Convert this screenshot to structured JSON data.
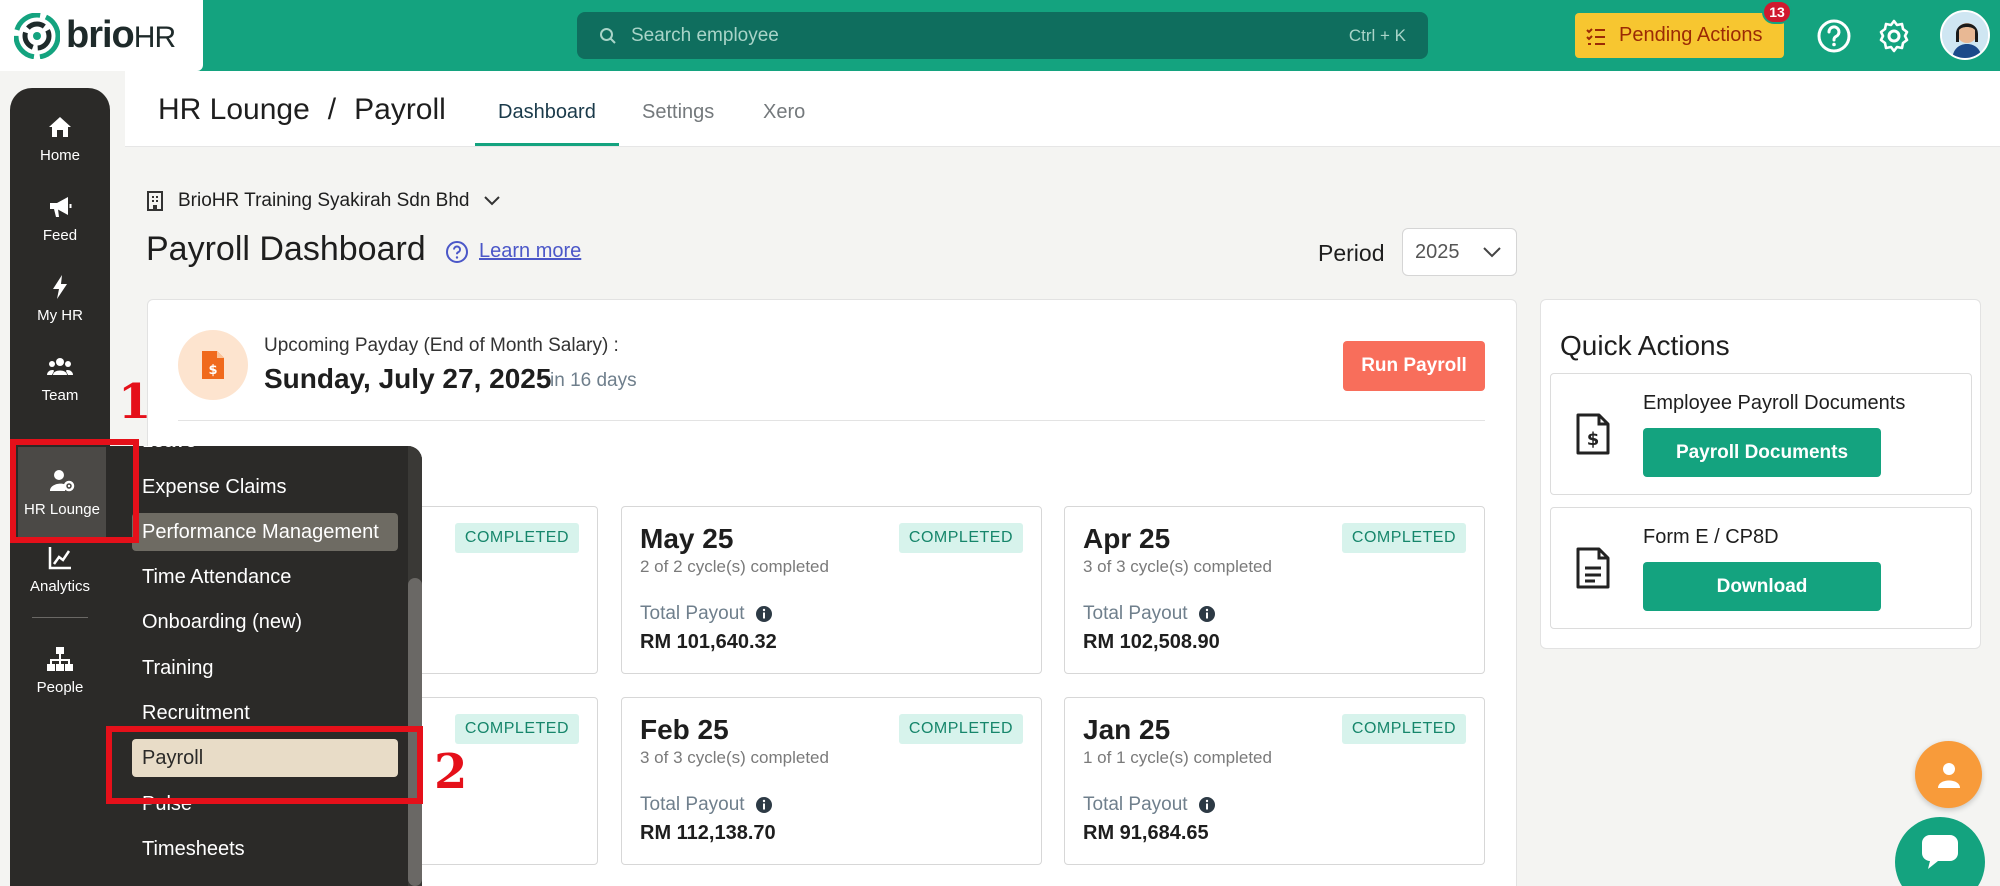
{
  "brand": {
    "name_bold": "brio",
    "name_light": "HR"
  },
  "search": {
    "placeholder": "Search employee",
    "shortcut": "Ctrl + K"
  },
  "pending_actions": {
    "label": "Pending Actions",
    "count": "13"
  },
  "sidebar": {
    "items": [
      {
        "label": "Home",
        "icon": "home-icon"
      },
      {
        "label": "Feed",
        "icon": "megaphone-icon"
      },
      {
        "label": "My HR",
        "icon": "bolt-icon"
      },
      {
        "label": "Team",
        "icon": "team-icon"
      },
      {
        "label": "HR Lounge",
        "icon": "user-gear-icon",
        "active": true
      },
      {
        "label": "Analytics",
        "icon": "analytics-icon"
      },
      {
        "label": "People",
        "icon": "org-chart-icon"
      }
    ]
  },
  "flyout": {
    "items": [
      "Leave",
      "Expense Claims",
      "Performance Management",
      "Time Attendance",
      "Onboarding (new)",
      "Training",
      "Recruitment",
      "Payroll",
      "Pulse",
      "Timesheets"
    ],
    "highlighted": "Performance Management",
    "selected": "Payroll"
  },
  "annotations": {
    "step1": "1",
    "step2": "2"
  },
  "header": {
    "breadcrumb": [
      "HR Lounge",
      "/",
      "Payroll"
    ],
    "tabs": [
      {
        "label": "Dashboard",
        "active": true
      },
      {
        "label": "Settings"
      },
      {
        "label": "Xero"
      }
    ]
  },
  "company": "BrioHR Training Syakirah Sdn Bhd",
  "page": {
    "title": "Payroll Dashboard",
    "learn_more": "Learn more",
    "period_label": "Period",
    "period_value": "2025"
  },
  "payday": {
    "label": "Upcoming Payday (End of Month Salary) :",
    "date": "Sunday, July 27, 2025",
    "in_days": "in 16 days",
    "run_button": "Run Payroll"
  },
  "payroll_cards": [
    {
      "month": "May 25",
      "cycles": "2 of 2 cycle(s) completed",
      "status": "COMPLETED",
      "total_label": "Total Payout",
      "total": "RM 101,640.32"
    },
    {
      "month": "Apr 25",
      "cycles": "3 of 3 cycle(s) completed",
      "status": "COMPLETED",
      "total_label": "Total Payout",
      "total": "RM 102,508.90"
    },
    {
      "month": "Feb 25",
      "cycles": "3 of 3 cycle(s) completed",
      "status": "COMPLETED",
      "total_label": "Total Payout",
      "total": "RM 112,138.70"
    },
    {
      "month": "Jan 25",
      "cycles": "1 of 1 cycle(s) completed",
      "status": "COMPLETED",
      "total_label": "Total Payout",
      "total": "RM 91,684.65"
    }
  ],
  "hidden_cards": [
    {
      "status": "COMPLETED"
    },
    {
      "status": "COMPLETED"
    }
  ],
  "quick_actions": {
    "title": "Quick Actions",
    "items": [
      {
        "label": "Employee Payroll Documents",
        "button": "Payroll Documents",
        "icon": "dollar-document-icon"
      },
      {
        "label": "Form E / CP8D",
        "button": "Download",
        "icon": "document-icon"
      }
    ]
  },
  "colors": {
    "brand_green": "#14a37f",
    "pending_yellow": "#f7c630",
    "run_payroll": "#f86e5b",
    "annotation_red": "#e5101a"
  }
}
